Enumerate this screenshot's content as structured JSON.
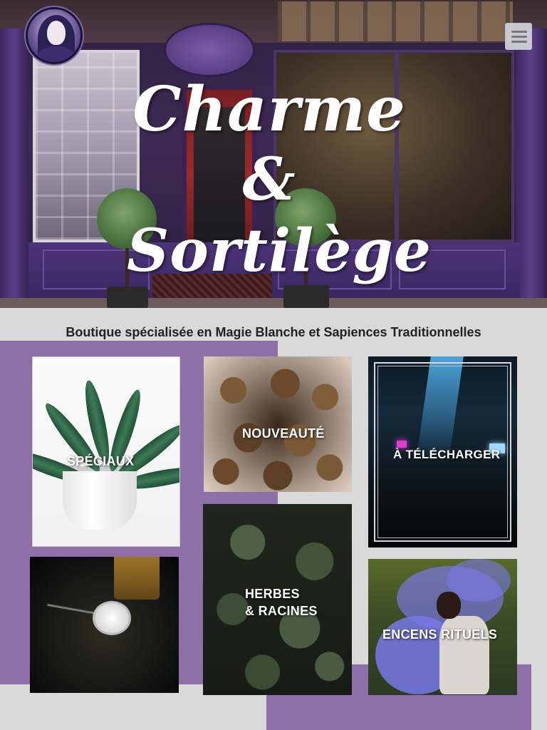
{
  "header": {
    "logo_alt": "Charme & Sortilège portrait logo",
    "title_line1": "Charme",
    "title_line2": "& Sortilège",
    "menu_icon": "hamburger-menu-icon"
  },
  "main": {
    "subtitle": "Boutique spécialisée en Magie Blanche et Sapiences Traditionnelles",
    "tiles": [
      {
        "label": "SPÉCIAUX",
        "image": "plant"
      },
      {
        "label": "NOUVEAUTÉ",
        "image": "pine-cones"
      },
      {
        "label": "À TÉLÉCHARGER",
        "image": "train-interior"
      },
      {
        "label": "",
        "image": "pocket-watch"
      },
      {
        "label_line1": "HERBES",
        "label_line2": "& RACINES",
        "image": "herbs"
      },
      {
        "label": "ENCENS RITUELS",
        "image": "purple-smoke"
      }
    ]
  },
  "colors": {
    "accent_purple": "#8f6fa8",
    "background_grey": "#d9d9d9",
    "storefront_purple": "#4b3479"
  }
}
